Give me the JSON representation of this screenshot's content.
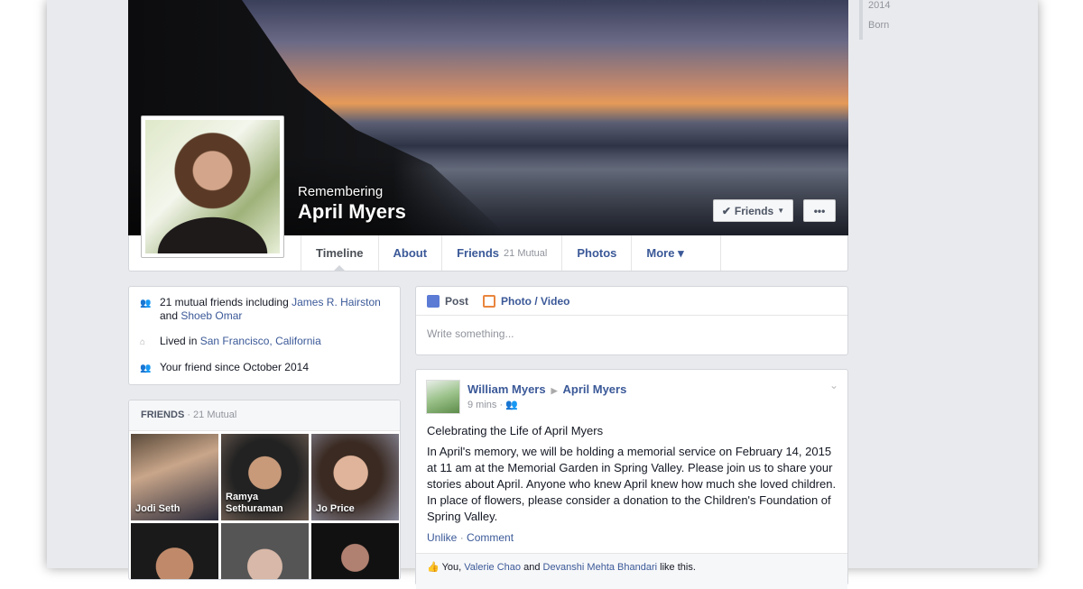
{
  "profile": {
    "remembering": "Remembering",
    "name": "April Myers",
    "friends_button": "Friends",
    "more_button": "•••"
  },
  "nav": {
    "tabs": [
      {
        "label": "Timeline"
      },
      {
        "label": "About"
      },
      {
        "label": "Friends",
        "sub": "21 Mutual"
      },
      {
        "label": "Photos"
      },
      {
        "label": "More ▾"
      }
    ]
  },
  "intro": {
    "mutual_prefix": "21 mutual friends including ",
    "mutual_a": "James R. Hairston",
    "mutual_and": " and ",
    "mutual_b": "Shoeb Omar",
    "lived_prefix": "Lived in ",
    "lived_place": "San Francisco, California",
    "since": "Your friend since October 2014"
  },
  "friends": {
    "title": "FRIENDS",
    "count": " · 21 Mutual",
    "items": [
      {
        "name": "Jodi Seth"
      },
      {
        "name": "Ramya Sethuraman"
      },
      {
        "name": "Jo Price"
      },
      {
        "name": ""
      },
      {
        "name": ""
      },
      {
        "name": ""
      }
    ]
  },
  "composer": {
    "post_tab": "Post",
    "photo_tab": "Photo / Video",
    "placeholder": "Write something..."
  },
  "post": {
    "author": "William Myers",
    "target": "April Myers",
    "time": "9 mins · ",
    "title": "Celebrating the Life of April Myers",
    "body": "In April's memory, we will be holding a memorial service on February 14, 2015 at 11 am at the Memorial Garden in Spring Valley. Please join us to share your stories about April. Anyone who knew April knew how much she loved children. In place of flowers, please consider a donation to the Children's Foundation of Spring Valley.",
    "unlike": "Unlike",
    "comment": "Comment",
    "likes_you": "You, ",
    "likes_a": "Valerie Chao",
    "likes_and": " and ",
    "likes_b": "Devanshi Mehta Bhandari",
    "likes_suffix": " like this."
  },
  "sidebar": {
    "years": [
      "2014",
      "Born"
    ]
  }
}
